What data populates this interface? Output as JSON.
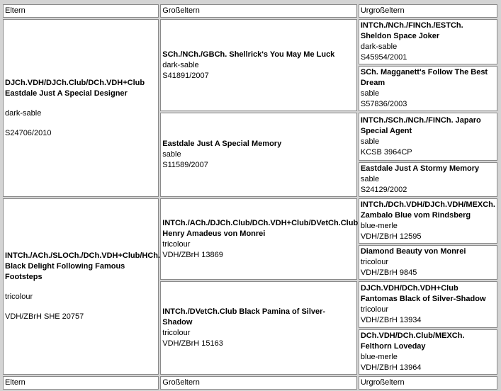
{
  "headers": {
    "col1": "Eltern",
    "col2": "Großeltern",
    "col3": "Urgroßeltern"
  },
  "footers": {
    "col1": "Eltern",
    "col2": "Großeltern",
    "col3": "Urgroßeltern"
  },
  "parents": [
    {
      "name": "DJCh.VDH/DJCh.Club/DCh.VDH+Club Eastdale Just A Special Designer",
      "color": "dark-sable",
      "reg": "S24706/2010"
    },
    {
      "name": "INTCh./ACh./SLOCh./DCh.VDH+Club/HCh. Black Delight Following Famous Footsteps",
      "color": "tricolour",
      "reg": "VDH/ZBrH SHE 20757"
    }
  ],
  "grandparents": [
    {
      "name": "SCh./NCh./GBCh. Shellrick's You May Me Luck",
      "color": "dark-sable",
      "reg": "S41891/2007"
    },
    {
      "name": "Eastdale Just A Special Memory",
      "color": "sable",
      "reg": "S11589/2007"
    },
    {
      "name": "INTCh./ACh./DJCh.Club/DCh.VDH+Club/DVetCh.Club Henry Amadeus von Monrei",
      "color": "tricolour",
      "reg": "VDH/ZBrH 13869"
    },
    {
      "name": "INTCh./DVetCh.Club Black Pamina of Silver-Shadow",
      "color": "tricolour",
      "reg": "VDH/ZBrH 15163"
    }
  ],
  "great_grandparents": [
    {
      "name": "INTCh./NCh./FINCh./ESTCh. Sheldon Space Joker",
      "color": "dark-sable",
      "reg": "S45954/2001"
    },
    {
      "name": "SCh. Magganett's Follow The Best Dream",
      "color": "sable",
      "reg": "S57836/2003"
    },
    {
      "name": "INTCh./SCh./NCh./FINCh. Japaro Special Agent",
      "color": "sable",
      "reg": "KCSB 3964CP"
    },
    {
      "name": "Eastdale Just A Stormy Memory",
      "color": "sable",
      "reg": "S24129/2002"
    },
    {
      "name": "INTCh./DCh.VDH/DJCh.VDH/MEXCh. Zambalo Blue vom Rindsberg",
      "color": "blue-merle",
      "reg": "VDH/ZBrH 12595"
    },
    {
      "name": "Diamond Beauty von Monrei",
      "color": "tricolour",
      "reg": "VDH/ZBrH 9845"
    },
    {
      "name": "DJCh.VDH/DCh.VDH+Club Fantomas Black of Silver-Shadow",
      "color": "tricolour",
      "reg": "VDH/ZBrH 13934"
    },
    {
      "name": "DCh.VDH/DCh.Club/MEXCh. Felthorn Loveday",
      "color": "blue-merle",
      "reg": "VDH/ZBrH 13964"
    }
  ],
  "colors": {
    "titled": "#e8141b",
    "untitled": "#000000",
    "background": "#d4d4d4",
    "border": "#8a8a8a"
  }
}
